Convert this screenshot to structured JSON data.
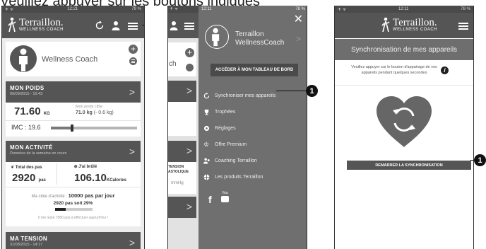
{
  "caption": "Veuillez appuyer sur les boutons indiqués",
  "screen1": {
    "status": {
      "left": "✈ ᯤ",
      "time": "12:21",
      "right": "79 %"
    },
    "brand": {
      "name": "Terraillon.",
      "sub": "WELLNESS COACH"
    },
    "profile": {
      "name": "Wellness Coach"
    },
    "poids": {
      "title": "MON POIDS",
      "date": "09/09/2015 - 15:43",
      "value": "71.60",
      "unit": "KG",
      "target_label": "Mon poids cible",
      "target_value": "71.0 kg",
      "target_diff": "(- 0.6 kg)",
      "imc_label": "IMC : 19.6"
    },
    "activite": {
      "title": "MON ACTIVITÉ",
      "subtitle": "Données de la semaine en cours",
      "steps_label": "Total des pas",
      "steps_value": "2920",
      "steps_unit": "pas",
      "burn_label": "J'ai brûlé",
      "burn_value": "106.10",
      "burn_unit": "KCalories",
      "goal_prefix": "Ma cible d'activité :",
      "goal_value": "10000 pas par jour",
      "progress": "2920 pas soit 29%",
      "progress_fraction": 0.29,
      "remaining": "Il me reste 7080 pas à effectuer aujourd'hui !"
    },
    "tension": {
      "title": "MA TENSION",
      "date": "31/08/2015 - 14:17"
    }
  },
  "screen2": {
    "status": {
      "left": "✈ ᯤ",
      "time": "12:11",
      "right": "78 %"
    },
    "peek": {
      "ch": "ch",
      "tension": "TENSION",
      "astolique": "ASTOLIQUE",
      "mmhg": "mmHg"
    },
    "user": "Terraillon WellnessCoach",
    "dashboard_button": "ACCÉDER À MON TABLEAU DE BORD",
    "menu": [
      {
        "label": "Synchroniser mes appareils",
        "icon": "sync-icon"
      },
      {
        "label": "Trophées",
        "icon": "trophy-icon"
      },
      {
        "label": "Réglages",
        "icon": "settings-icon"
      },
      {
        "label": "Offre Premium",
        "icon": "premium-icon"
      },
      {
        "label": "Coaching Terraillon",
        "icon": "coaching-icon"
      },
      {
        "label": "Les produits Terraillon",
        "icon": "products-icon"
      }
    ],
    "social": {
      "facebook": "f",
      "youtube": "You"
    }
  },
  "screen3": {
    "status": {
      "left": "✈ ᯤ",
      "time": "12:11",
      "right": "78 %"
    },
    "brand": {
      "name": "Terraillon.",
      "sub": "WELLNESS COACH"
    },
    "title": "Synchronisation de mes appareils",
    "instruction": "Veuillez appuyer sur le bouton d'appairage de vos appareils pendant quelques secondes",
    "info_icon": "i",
    "button": "DEMARRER LA SYNCHRONISATION"
  },
  "callout_number": "1"
}
